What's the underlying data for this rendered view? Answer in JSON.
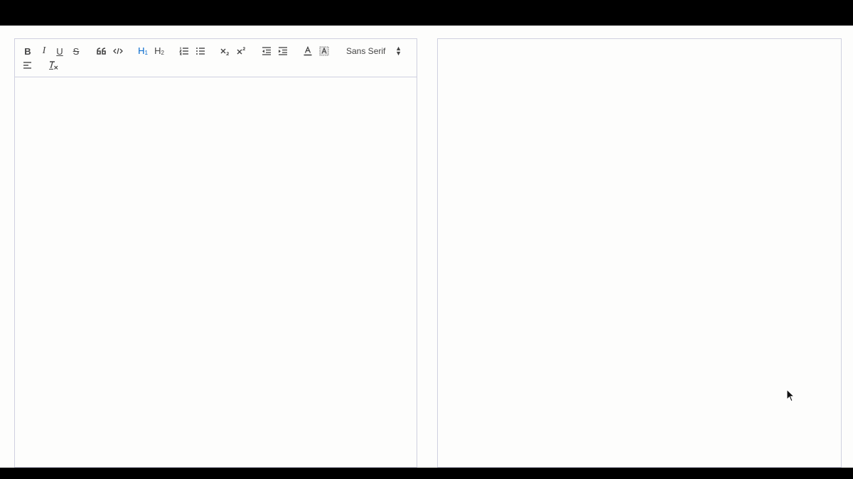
{
  "toolbar": {
    "bold": "B",
    "italic": "I",
    "underline": "U",
    "strike": "S",
    "header1": "H",
    "header1_sub": "1",
    "header2": "H",
    "header2_sub": "2",
    "font_select_value": "Sans Serif"
  },
  "icons": {
    "bold": "bold-icon",
    "italic": "italic-icon",
    "underline": "underline-icon",
    "strike": "strike-icon",
    "blockquote": "blockquote-icon",
    "code_block": "code-block-icon",
    "ordered_list": "ordered-list-icon",
    "bullet_list": "bullet-list-icon",
    "subscript": "subscript-icon",
    "superscript": "superscript-icon",
    "outdent": "outdent-icon",
    "indent": "indent-icon",
    "text_color": "text-color-icon",
    "background_color": "background-color-icon",
    "align": "align-left-icon",
    "clean": "clear-formatting-icon"
  },
  "colors": {
    "active": "#0066cc",
    "icon": "#444444",
    "border": "#cfd0e0",
    "background": "#fdfdfc"
  }
}
